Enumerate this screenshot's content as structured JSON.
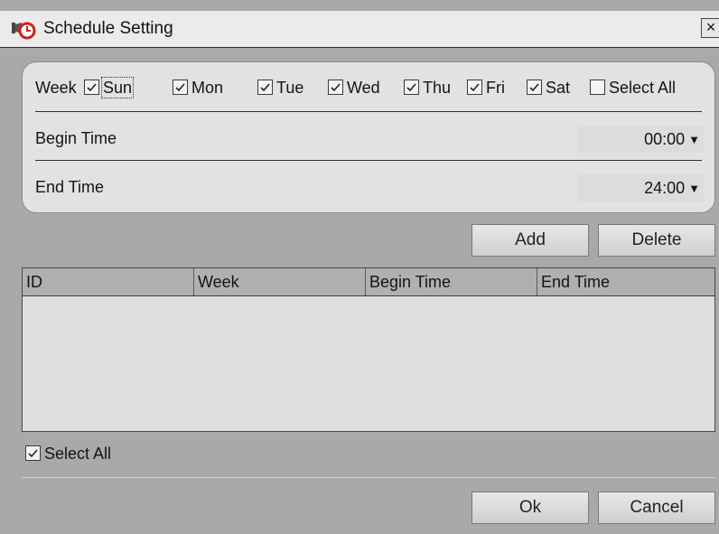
{
  "window": {
    "title": "Schedule Setting",
    "close_label": "×"
  },
  "week": {
    "label": "Week",
    "days": [
      {
        "label": "Sun",
        "checked": true
      },
      {
        "label": "Mon",
        "checked": true
      },
      {
        "label": "Tue",
        "checked": true
      },
      {
        "label": "Wed",
        "checked": true
      },
      {
        "label": "Thu",
        "checked": true
      },
      {
        "label": "Fri",
        "checked": true
      },
      {
        "label": "Sat",
        "checked": true
      }
    ],
    "select_all": {
      "label": "Select All",
      "checked": false
    }
  },
  "begin_time": {
    "label": "Begin Time",
    "value": "00:00"
  },
  "end_time": {
    "label": "End Time",
    "value": "24:00"
  },
  "actions": {
    "add": "Add",
    "delete": "Delete"
  },
  "table": {
    "columns": [
      "ID",
      "Week",
      "Begin Time",
      "End Time"
    ],
    "rows": []
  },
  "bottom_select_all": {
    "label": "Select All",
    "checked": true
  },
  "footer": {
    "ok": "Ok",
    "cancel": "Cancel"
  },
  "icons": {
    "title": "alarm-clock-icon",
    "dropdown": "caret-down-icon",
    "check": "check-icon"
  }
}
